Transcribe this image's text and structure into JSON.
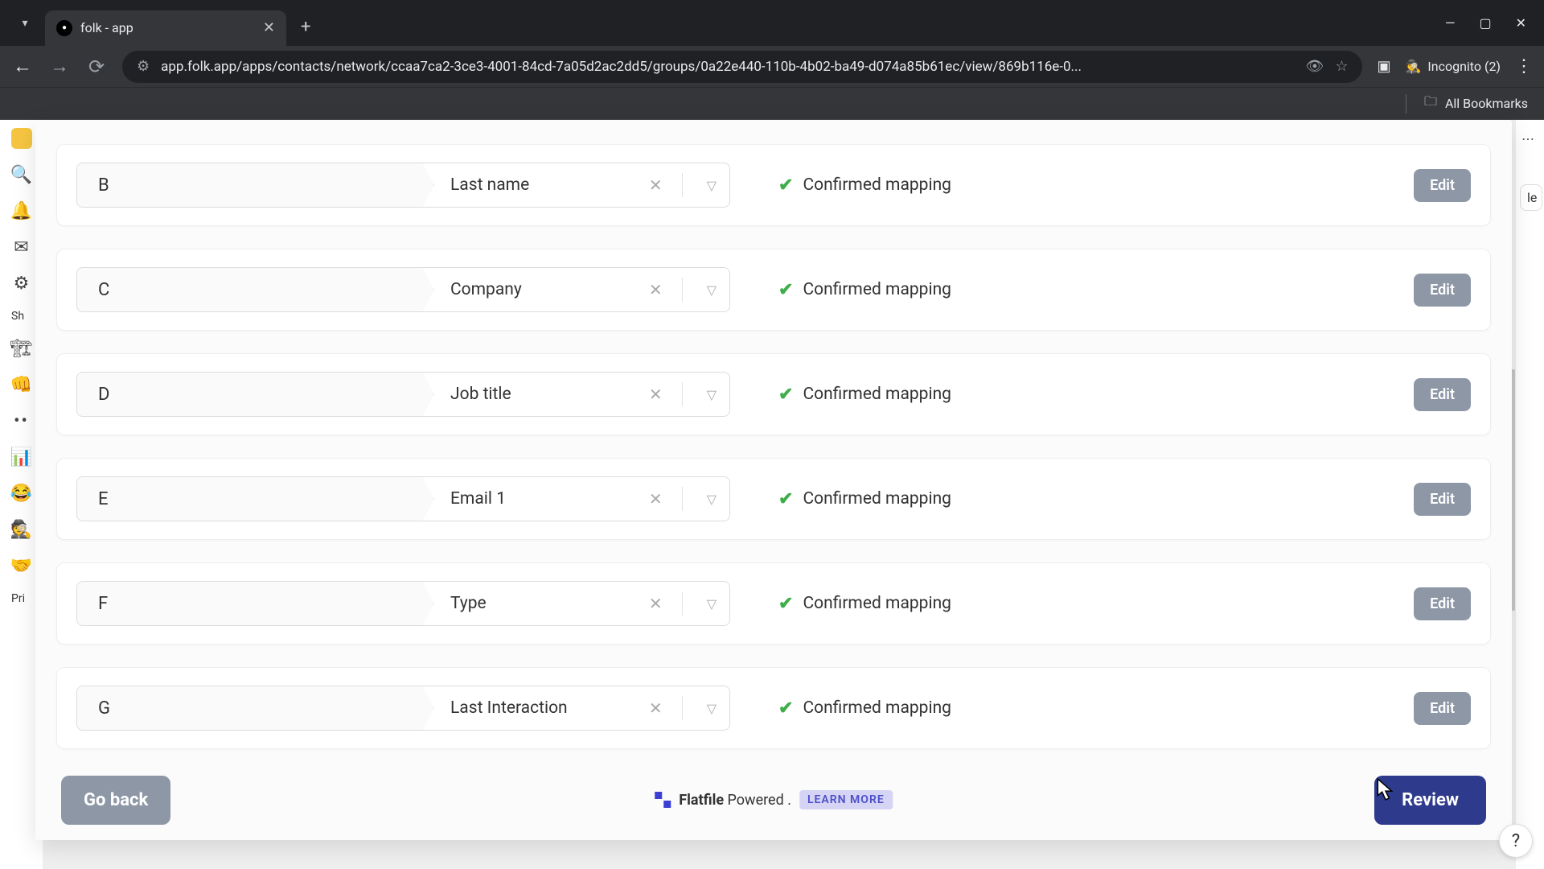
{
  "browser": {
    "tab_title": "folk - app",
    "url": "app.folk.app/apps/contacts/network/ccaa7ca2-3ce3-4001-84cd-7a05d2ac2dd5/groups/0a22e440-110b-4b02-ba49-d074a85b61ec/view/869b116e-0...",
    "incognito_label": "Incognito (2)",
    "all_bookmarks": "All Bookmarks"
  },
  "left_rail": {
    "section1": "Sh",
    "section2": "Pri"
  },
  "right_peek": "le",
  "mapping": {
    "rows": [
      {
        "col": "B",
        "field": "Last name",
        "status": "Confirmed mapping",
        "edit": "Edit"
      },
      {
        "col": "C",
        "field": "Company",
        "status": "Confirmed mapping",
        "edit": "Edit"
      },
      {
        "col": "D",
        "field": "Job title",
        "status": "Confirmed mapping",
        "edit": "Edit"
      },
      {
        "col": "E",
        "field": "Email 1",
        "status": "Confirmed mapping",
        "edit": "Edit"
      },
      {
        "col": "F",
        "field": "Type",
        "status": "Confirmed mapping",
        "edit": "Edit"
      },
      {
        "col": "G",
        "field": "Last Interaction",
        "status": "Confirmed mapping",
        "edit": "Edit"
      }
    ]
  },
  "footer": {
    "go_back": "Go back",
    "powered_brand": "Flatfile",
    "powered_suffix": " Powered .",
    "learn_more": "LEARN MORE",
    "review": "Review"
  },
  "help": "?"
}
